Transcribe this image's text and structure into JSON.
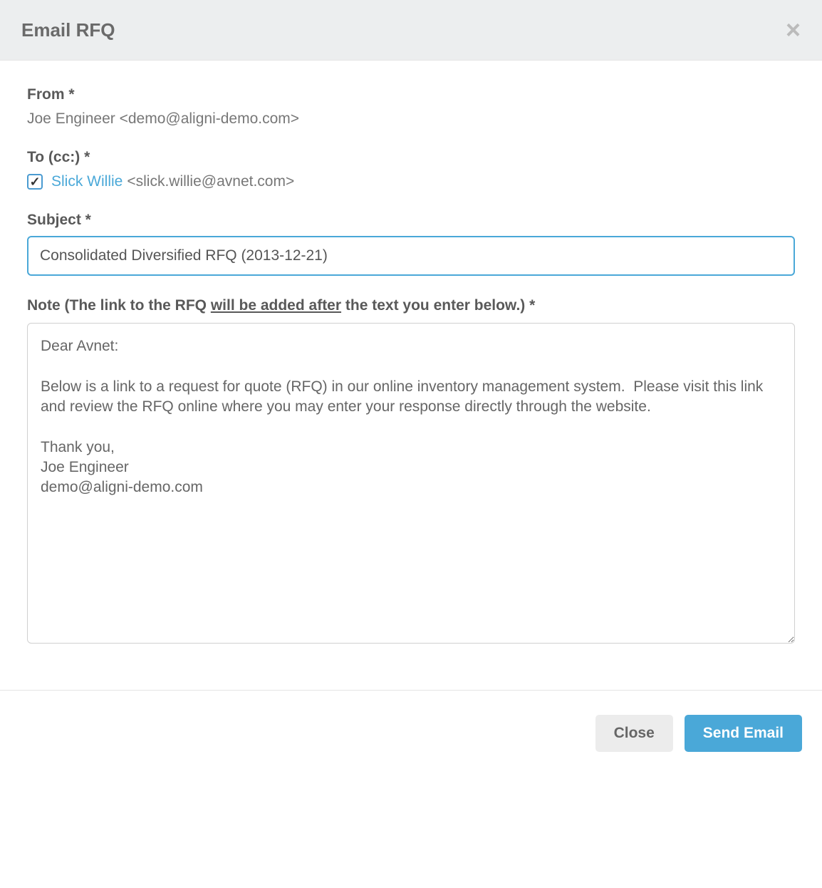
{
  "header": {
    "title": "Email RFQ"
  },
  "from": {
    "label": "From *",
    "value": "Joe Engineer <demo@aligni-demo.com>"
  },
  "to": {
    "label": "To (cc:) *",
    "recipient_name": "Slick Willie",
    "recipient_email": " <slick.willie@avnet.com>"
  },
  "subject": {
    "label": "Subject *",
    "value": "Consolidated Diversified RFQ (2013-12-21)"
  },
  "note": {
    "label_prefix": "Note (The link to the RFQ ",
    "label_underlined": "will be added after",
    "label_suffix": " the text you enter below.) *",
    "value": "Dear Avnet:\n\nBelow is a link to a request for quote (RFQ) in our online inventory management system.  Please visit this link and review the RFQ online where you may enter your response directly through the website.\n\nThank you,\nJoe Engineer\ndemo@aligni-demo.com"
  },
  "footer": {
    "close_label": "Close",
    "send_label": "Send Email"
  }
}
